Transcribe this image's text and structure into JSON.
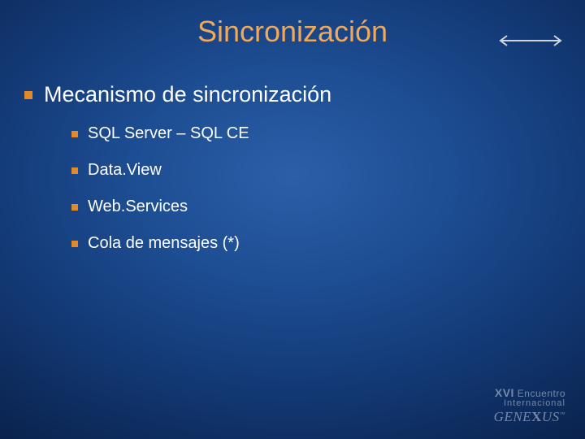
{
  "title": "Sincronización",
  "bullets": {
    "main": "Mecanismo de sincronización",
    "items": [
      "SQL Server – SQL CE",
      "Data.View",
      "Web.Services",
      "Cola de mensajes (*)"
    ]
  },
  "logo": {
    "line1_prefix": "XVI",
    "line1_rest": " Encuentro",
    "line2": "Internacional",
    "brand_a": "G",
    "brand_b": "ENE",
    "brand_c": "X",
    "brand_d": "US",
    "tm": "™"
  },
  "colors": {
    "title": "#f0a85a",
    "bullet_square": "#e08a2a",
    "text": "#ffffff",
    "arrow": "#d0d6e0"
  }
}
